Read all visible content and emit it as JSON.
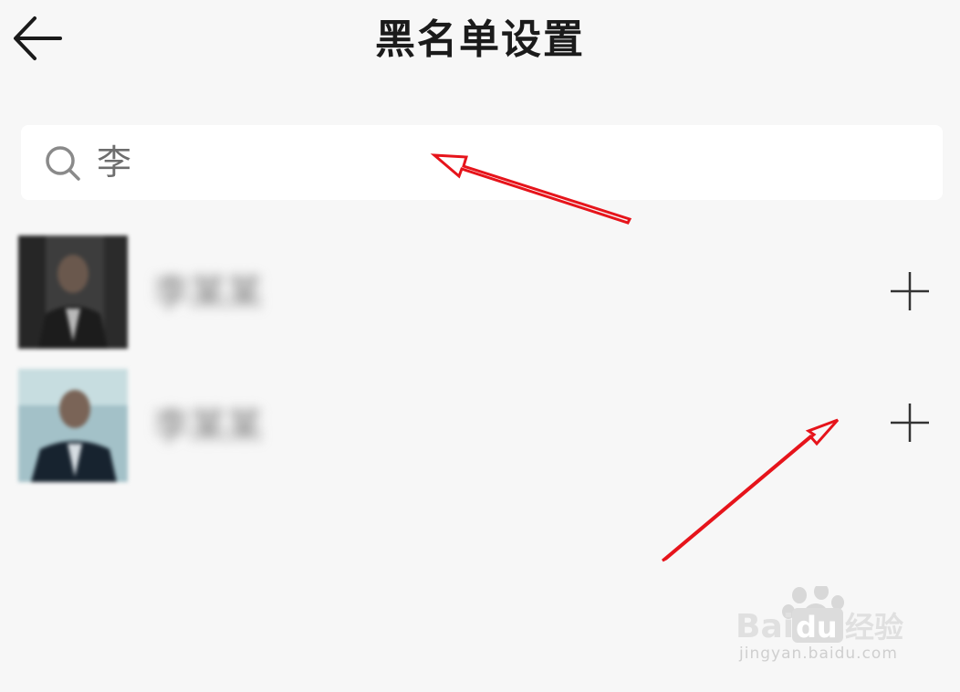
{
  "header": {
    "title": "黑名单设置",
    "back_icon": "arrow-left-icon"
  },
  "search": {
    "value": "李",
    "icon": "search-icon"
  },
  "contacts": [
    {
      "name": "李某某",
      "action_icon": "plus-icon"
    },
    {
      "name": "李某某",
      "action_icon": "plus-icon"
    }
  ],
  "colors": {
    "background": "#f7f7f7",
    "search_bg": "#ffffff",
    "title": "#1b1b1b",
    "annotation_arrow": "#e6141b"
  },
  "watermark": {
    "brand": "Baidu经验",
    "url": "jingyan.baidu.com"
  }
}
